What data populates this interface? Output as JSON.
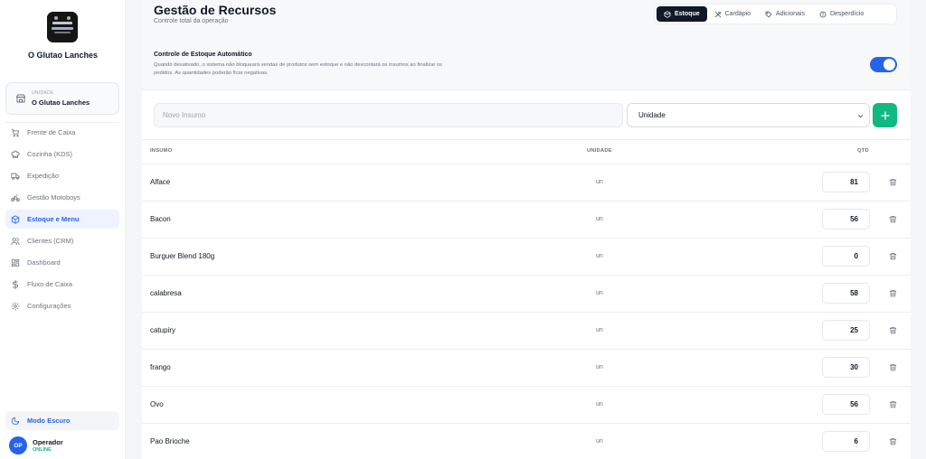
{
  "sidebar": {
    "brand_name": "O Glutao Lanches",
    "unit": {
      "label": "UNIDADE",
      "name": "O Glutao Lanches"
    },
    "nav": [
      {
        "label": "Frente de Caixa",
        "icon": "cart-icon"
      },
      {
        "label": "Cozinha (KDS)",
        "icon": "chef-hat-icon"
      },
      {
        "label": "Expedição",
        "icon": "truck-icon"
      },
      {
        "label": "Gestão Motoboys",
        "icon": "bike-icon"
      },
      {
        "label": "Estoque e Menu",
        "icon": "box-icon",
        "active": true
      },
      {
        "label": "Clientes (CRM)",
        "icon": "users-icon"
      },
      {
        "label": "Dashboard",
        "icon": "grid-icon"
      },
      {
        "label": "Fluxo de Caixa",
        "icon": "dollar-icon"
      },
      {
        "label": "Configurações",
        "icon": "gear-icon"
      }
    ],
    "dark_mode_label": "Modo Escuro",
    "operator": {
      "initials": "OP",
      "name": "Operador",
      "status": "ONLINE"
    }
  },
  "header": {
    "title": "Gestão de Recursos",
    "subtitle": "Controle total da operação",
    "tabs": [
      {
        "label": "Estoque",
        "active": true
      },
      {
        "label": "Cardápio"
      },
      {
        "label": "Adicionais"
      },
      {
        "label": "Desperdício"
      }
    ]
  },
  "auto_control": {
    "title": "Controle de Estoque Automático",
    "description": "Quando desativado, o sistema não bloqueará vendas de produtos sem estoque e não descontará os insumos ao finalizar os pedidos. As quantidades poderão ficar negativas.",
    "enabled": true
  },
  "form": {
    "insumo_placeholder": "Novo Insumo",
    "unit_select_value": "Unidade"
  },
  "table": {
    "headers": {
      "insumo": "INSUMO",
      "unidade": "UNIDADE",
      "qtd": "QTD"
    },
    "rows": [
      {
        "name": "Alface",
        "unit": "un",
        "qty": "81"
      },
      {
        "name": "Bacon",
        "unit": "un",
        "qty": "56"
      },
      {
        "name": "Burguer Blend 180g",
        "unit": "un",
        "qty": "0"
      },
      {
        "name": "calabresa",
        "unit": "un",
        "qty": "58"
      },
      {
        "name": "catupiry",
        "unit": "un",
        "qty": "25"
      },
      {
        "name": "frango",
        "unit": "un",
        "qty": "30"
      },
      {
        "name": "Ovo",
        "unit": "un",
        "qty": "56"
      },
      {
        "name": "Pao Brioche",
        "unit": "un",
        "qty": "6"
      }
    ]
  },
  "colors": {
    "accent": "#2563eb",
    "success": "#10b981",
    "dark": "#111827"
  }
}
